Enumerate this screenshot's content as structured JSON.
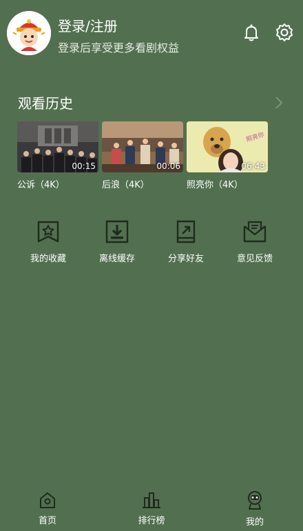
{
  "header": {
    "login_title": "登录/注册",
    "login_subtitle": "登录后享受更多看剧权益",
    "avatar_icon": "avatar-mascot-icon",
    "notification_icon": "bell-icon",
    "settings_icon": "gear-icon"
  },
  "history": {
    "title": "观看历史",
    "more_icon": "chevron-right-icon",
    "items": [
      {
        "title": "公诉（4K）",
        "duration": "00:15"
      },
      {
        "title": "后浪（4K）",
        "duration": "00:06"
      },
      {
        "title": "照亮你（4K）",
        "duration": "06:43"
      }
    ]
  },
  "actions": [
    {
      "label": "我的收藏",
      "icon": "favorites-star-icon"
    },
    {
      "label": "离线缓存",
      "icon": "download-icon"
    },
    {
      "label": "分享好友",
      "icon": "share-icon"
    },
    {
      "label": "意见反馈",
      "icon": "feedback-mail-icon"
    }
  ],
  "bottom_nav": [
    {
      "label": "首页",
      "icon": "home-icon"
    },
    {
      "label": "排行榜",
      "icon": "ranking-icon"
    },
    {
      "label": "我的",
      "icon": "profile-robot-icon",
      "active": true
    }
  ],
  "colors": {
    "background": "#52704f",
    "text": "#ffffff",
    "icon_stroke": "#1f2a1e"
  }
}
